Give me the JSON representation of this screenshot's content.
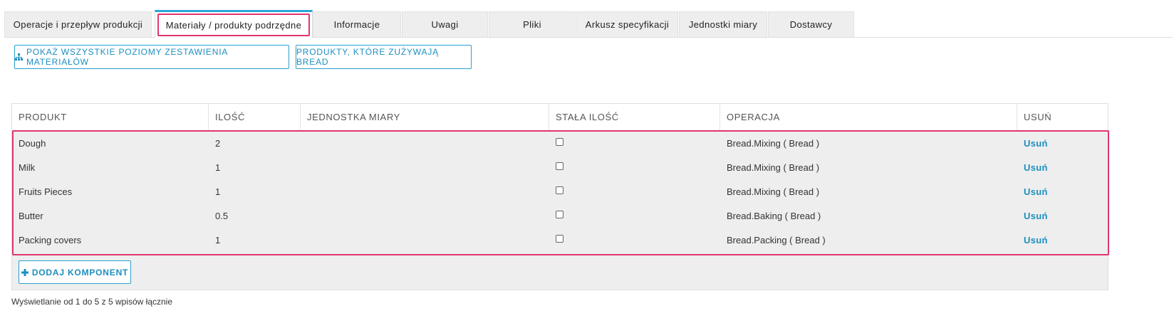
{
  "tabs": [
    {
      "label": "Operacje i przepływ produkcji",
      "active": false
    },
    {
      "label": "Materiały / produkty podrzędne",
      "active": true
    },
    {
      "label": "Informacje",
      "active": false
    },
    {
      "label": "Uwagi",
      "active": false
    },
    {
      "label": "Pliki",
      "active": false
    },
    {
      "label": "Arkusz specyfikacji",
      "active": false
    },
    {
      "label": "Jednostki miary",
      "active": false
    },
    {
      "label": "Dostawcy",
      "active": false
    }
  ],
  "actions": {
    "show_all_levels_label": "POKAŻ WSZYSTKIE POZIOMY ZESTAWIENIA MATERIAŁÓW",
    "products_using_label": "PRODUKTY, KTÓRE ZUŻYWAJĄ BREAD"
  },
  "table": {
    "columns": [
      "PRODUKT",
      "ILOŚĆ",
      "JEDNOSTKA MIARY",
      "STAŁA ILOŚĆ",
      "OPERACJA",
      "USUŃ"
    ],
    "rows": [
      {
        "product": "Dough",
        "qty": "2",
        "unit": "",
        "fixed": false,
        "operation": "Bread.Mixing ( Bread )",
        "remove": "Usuń"
      },
      {
        "product": "Milk",
        "qty": "1",
        "unit": "",
        "fixed": false,
        "operation": "Bread.Mixing ( Bread )",
        "remove": "Usuń"
      },
      {
        "product": "Fruits Pieces",
        "qty": "1",
        "unit": "",
        "fixed": false,
        "operation": "Bread.Mixing ( Bread )",
        "remove": "Usuń"
      },
      {
        "product": "Butter",
        "qty": "0.5",
        "unit": "",
        "fixed": false,
        "operation": "Bread.Baking ( Bread )",
        "remove": "Usuń"
      },
      {
        "product": "Packing covers",
        "qty": "1",
        "unit": "",
        "fixed": false,
        "operation": "Bread.Packing ( Bread )",
        "remove": "Usuń"
      }
    ]
  },
  "add_component_label": "DODAJ KOMPONENT",
  "footer_text": "Wyświetlanie od 1 do 5 z 5 wpisów łącznie",
  "colors": {
    "accent": "#1b8fc0",
    "highlight": "#e0356f",
    "active_tab_top": "#2aa7d6"
  },
  "icons": {
    "show_all_levels": "sitemap-icon",
    "add_component": "plus-icon"
  }
}
